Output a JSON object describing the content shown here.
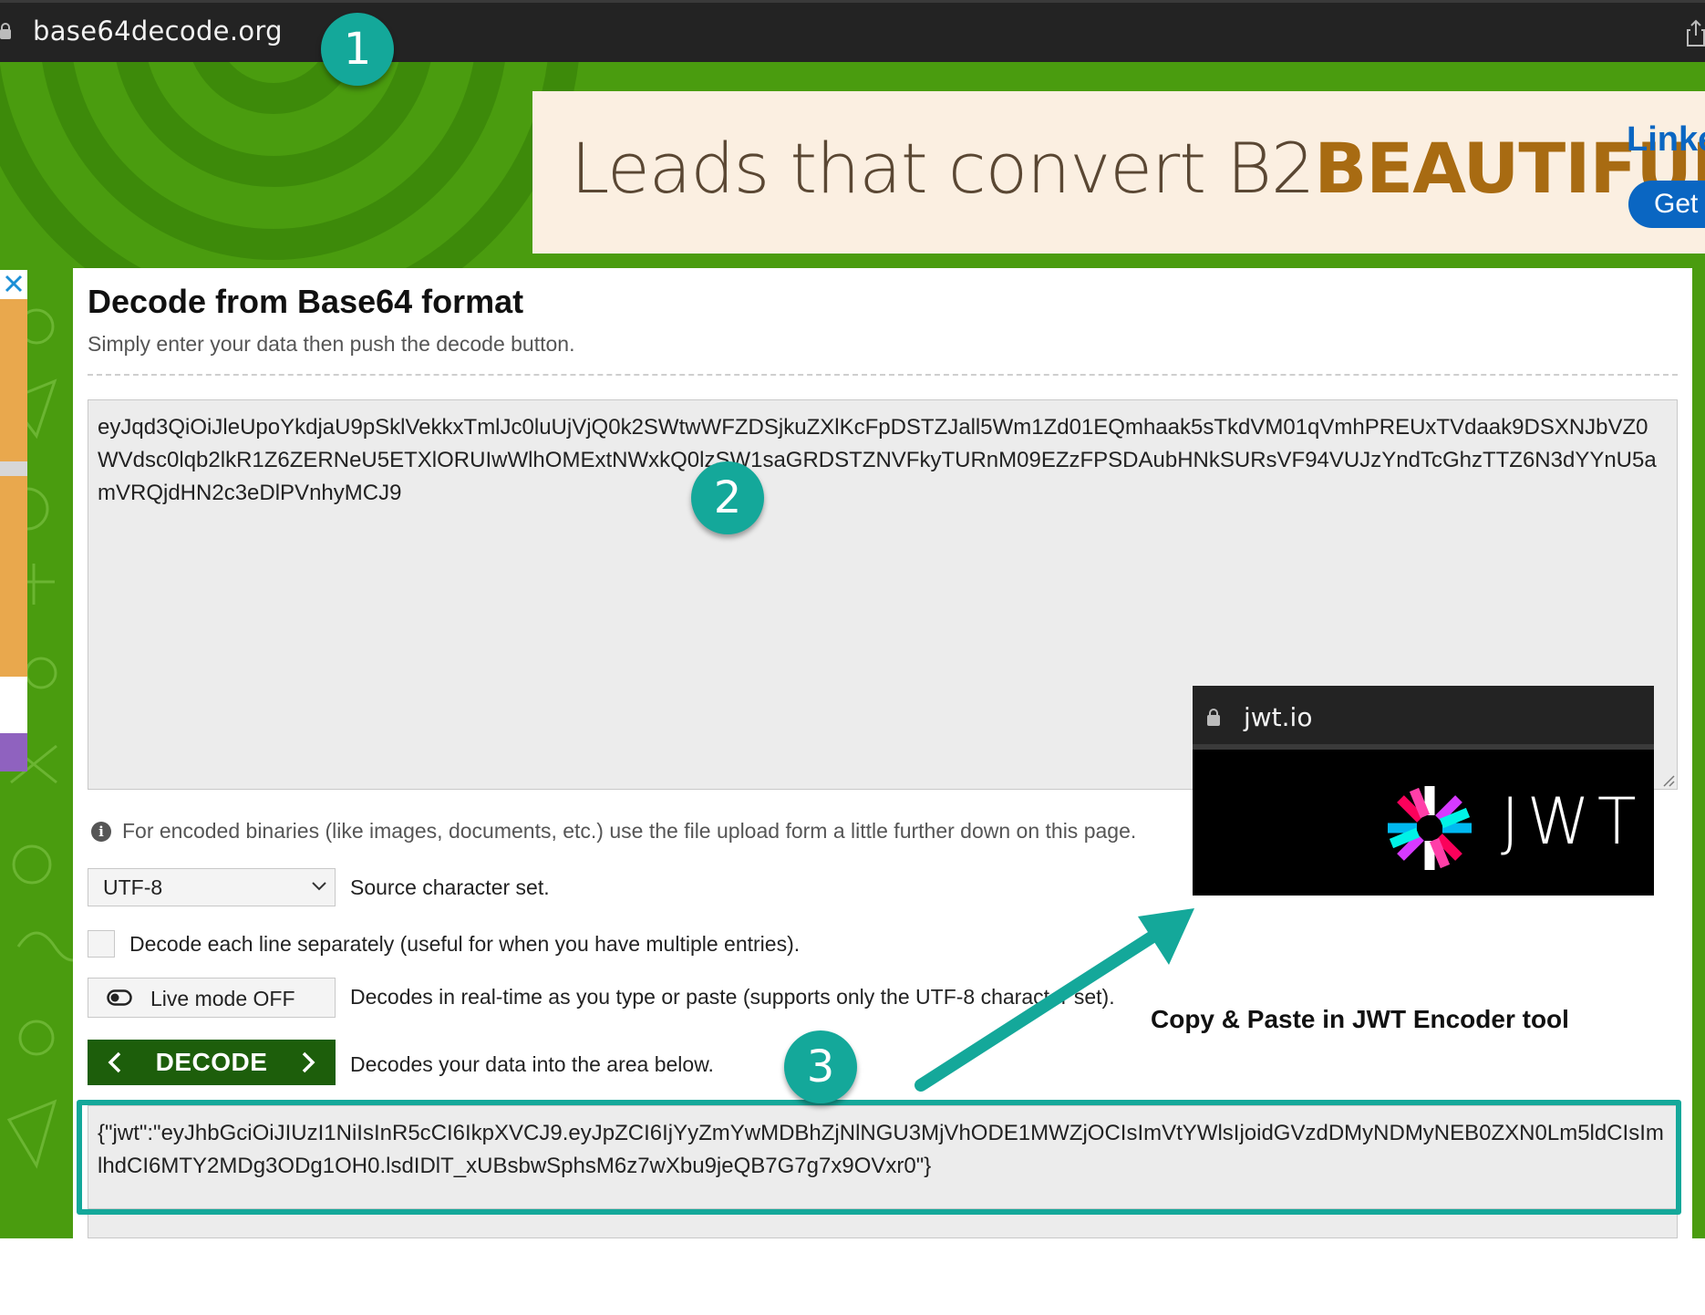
{
  "browser": {
    "url": "base64decode.org"
  },
  "ad": {
    "headline_light": "Leads that convert B2",
    "headline_bold": "BEAUTIFULLY",
    "brand": "Linke",
    "cta": "Get"
  },
  "page": {
    "title": "Decode from Base64 format",
    "subtitle": "Simply enter your data then push the decode button.",
    "input_value": "eyJqd3QiOiJleUpoYkdjaU9pSklVekkxTmlJc0luUjVjQ0k2SWtwWFZDSjkuZXlKcFpDSTZJall5Wm1Zd01EQmhaak5sTkdVM01qVmhPREUxTVdaak9DSXNJbVZ0WVdsc0lqb2lkR1Z6ZERNeU5ETXlORUIwWlhOMExtNWxkQ0lzSW1saGRDSTZNVFkyTURnM09EZzFPSDAubHNkSURsVF94VUJzYndTcGhzTTZ6N3dYYnU5amVRQjdHN2c3eDlPVnhyMCJ9",
    "binary_note": "For encoded binaries (like images, documents, etc.) use the file upload form a little further down on this page.",
    "charset_value": "UTF-8",
    "charset_label": "Source character set.",
    "lines_label": "Decode each line separately (useful for when you have multiple entries).",
    "live_button": "Live mode OFF",
    "live_label": "Decodes in real-time as you type or paste (supports only the UTF-8 character set).",
    "decode_button": "DECODE",
    "decode_label": "Decodes your data into the area below.",
    "output_value": "{\"jwt\":\"eyJhbGciOiJIUzI1NiIsInR5cCI6IkpXVCJ9.eyJpZCI6IjYyZmYwMDBhZjNlNGU3MjVhODE1MWZjOCIsImVtYWlsIjoidGVzdDMyNDMyNEB0ZXN0Lm5ldCIsImlhdCI6MTY2MDg3ODg1OH0.lsdIDlT_xUBsbwSphsM6z7wXbu9jeQB7G7g7x9OVxr0\"}"
  },
  "overlay": {
    "url": "jwt.io",
    "logo_word": "JWT"
  },
  "annotations": {
    "step1": "1",
    "step2": "2",
    "step3": "3",
    "caption": "Copy & Paste in JWT Encoder  tool"
  },
  "colors": {
    "green_bg": "#4a9c0f",
    "decode_button": "#1d5e0b",
    "annotation_teal": "#14a89a",
    "ad_bg": "#fbefe1",
    "linkedin_blue": "#0a66c2"
  },
  "icons": [
    "lock-icon",
    "share-icon",
    "close-icon",
    "info-icon",
    "chevron-down-icon",
    "toggle-icon",
    "chevron-left-icon",
    "chevron-right-icon",
    "resize-grip-icon",
    "jwt-logo-icon"
  ]
}
